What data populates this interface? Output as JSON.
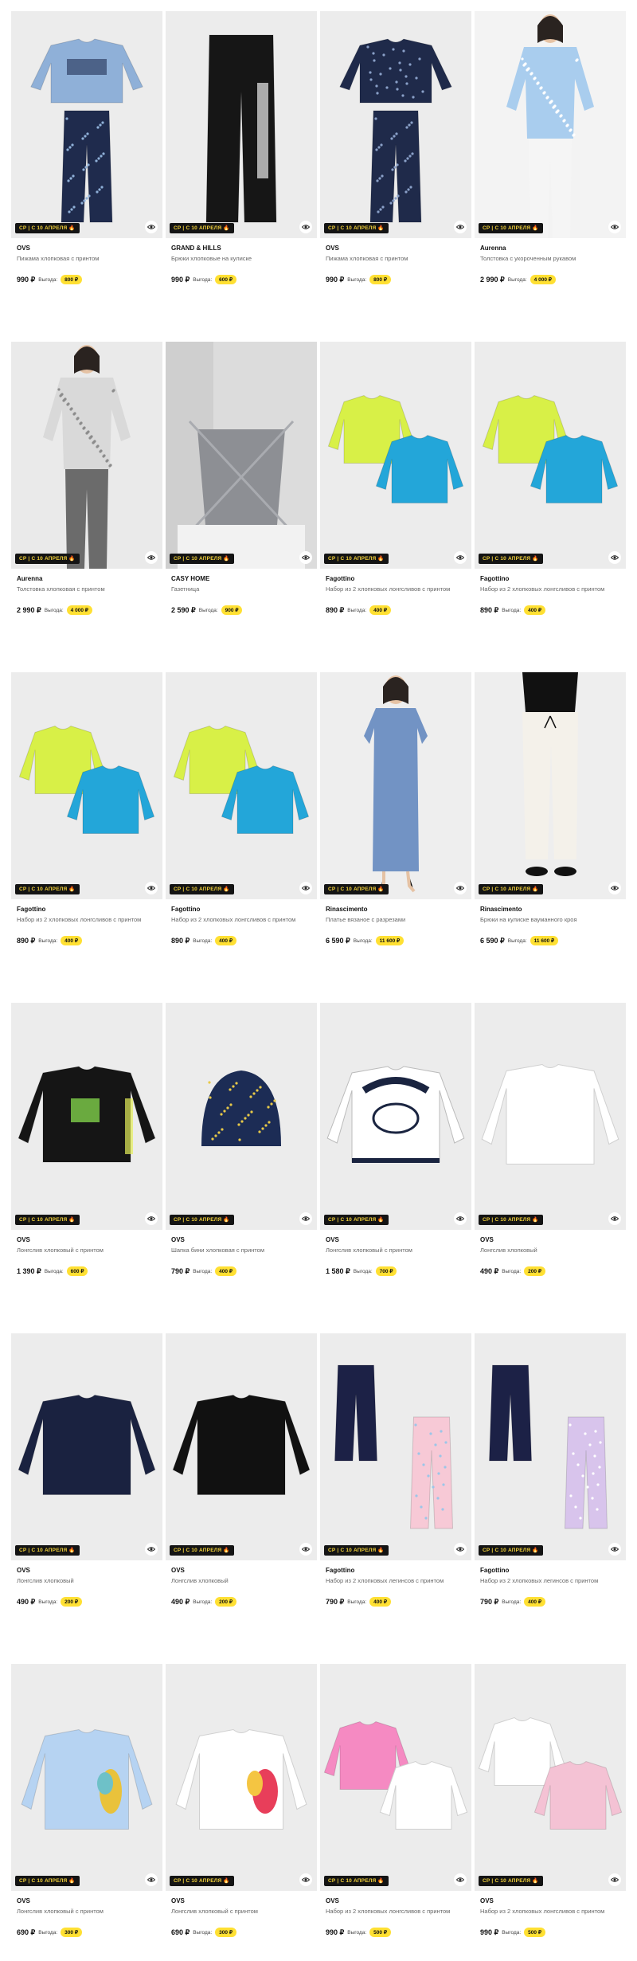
{
  "badge_text": "СР | С 10 АПРЕЛЯ 🔥",
  "save_label": "Выгода:",
  "products": [
    {
      "brand": "OVS",
      "title": "Пижама хлопковая с принтом",
      "price": "990 ₽",
      "save": "800 ₽",
      "icon": "kids-pajama-blue"
    },
    {
      "brand": "GRAND & HILLS",
      "title": "Брюки хлопковые на кулиске",
      "price": "990 ₽",
      "save": "600 ₽",
      "icon": "black-sweatpants"
    },
    {
      "brand": "OVS",
      "title": "Пижама хлопковая с принтом",
      "price": "990 ₽",
      "save": "800 ₽",
      "icon": "kids-pajama-navy"
    },
    {
      "brand": "Aurenna",
      "title": "Толстовка с укороченным рукавом",
      "price": "2 990 ₽",
      "save": "4 000 ₽",
      "icon": "model-blue-top"
    },
    {
      "brand": "Aurenna",
      "title": "Толстовка хлопковая с принтом",
      "price": "2 990 ₽",
      "save": "4 000 ₽",
      "icon": "model-grey-top"
    },
    {
      "brand": "CASY HOME",
      "title": "Газетница",
      "price": "2 590 ₽",
      "save": "900 ₽",
      "icon": "magazine-rack"
    },
    {
      "brand": "Fagottino",
      "title": "Набор из 2 хлопковых лонгсливов с принтом",
      "price": "890 ₽",
      "save": "400 ₽",
      "icon": "two-longsleeves"
    },
    {
      "brand": "Fagottino",
      "title": "Набор из 2 хлопковых лонгсливов с принтом",
      "price": "890 ₽",
      "save": "400 ₽",
      "icon": "two-longsleeves"
    },
    {
      "brand": "Fagottino",
      "title": "Набор из 2 хлопковых лонгсливов с принтом",
      "price": "890 ₽",
      "save": "400 ₽",
      "icon": "two-longsleeves"
    },
    {
      "brand": "Fagottino",
      "title": "Набор из 2 хлопковых лонгсливов с принтом",
      "price": "890 ₽",
      "save": "400 ₽",
      "icon": "two-longsleeves"
    },
    {
      "brand": "Rinascimento",
      "title": "Платье вязаное с разрезами",
      "price": "6 590 ₽",
      "save": "11 600 ₽",
      "icon": "model-blue-dress"
    },
    {
      "brand": "Rinascimento",
      "title": "Брюки на кулиске вауманного кроя",
      "price": "6 590 ₽",
      "save": "11 600 ₽",
      "icon": "model-white-pants"
    },
    {
      "brand": "OVS",
      "title": "Лонгслив хлопковый с принтом",
      "price": "1 390 ₽",
      "save": "600 ₽",
      "icon": "black-sweatshirt"
    },
    {
      "brand": "OVS",
      "title": "Шапка бини хлопковая с принтом",
      "price": "790 ₽",
      "save": "400 ₽",
      "icon": "beanie"
    },
    {
      "brand": "OVS",
      "title": "Лонгслив хлопковый с принтом",
      "price": "1 580 ₽",
      "save": "700 ₽",
      "icon": "athletics-sweatshirt"
    },
    {
      "brand": "OVS",
      "title": "Лонгслив хлопковый",
      "price": "490 ₽",
      "save": "200 ₽",
      "icon": "white-longsleeve"
    },
    {
      "brand": "OVS",
      "title": "Лонгслив хлопковый",
      "price": "490 ₽",
      "save": "200 ₽",
      "icon": "navy-longsleeve"
    },
    {
      "brand": "OVS",
      "title": "Лонгслив хлопковый",
      "price": "490 ₽",
      "save": "200 ₽",
      "icon": "black-longsleeve"
    },
    {
      "brand": "Fagottino",
      "title": "Набор из 2 хлопковых легинсов с принтом",
      "price": "790 ₽",
      "save": "400 ₽",
      "icon": "two-leggings-pink"
    },
    {
      "brand": "Fagottino",
      "title": "Набор из 2 хлопковых легинсов с принтом",
      "price": "790 ₽",
      "save": "400 ₽",
      "icon": "two-leggings-lilac"
    },
    {
      "brand": "OVS",
      "title": "Лонгслив хлопковый с принтом",
      "price": "690 ₽",
      "save": "300 ₽",
      "icon": "blue-longsleeve-print"
    },
    {
      "brand": "OVS",
      "title": "Лонгслив хлопковый с принтом",
      "price": "690 ₽",
      "save": "300 ₽",
      "icon": "white-longsleeve-print"
    },
    {
      "brand": "OVS",
      "title": "Набор из 2 хлопковых лонгсливов с принтом",
      "price": "990 ₽",
      "save": "500 ₽",
      "icon": "two-longsleeves-pink"
    },
    {
      "brand": "OVS",
      "title": "Набор из 2 хлопковых лонгсливов с принтом",
      "price": "990 ₽",
      "save": "500 ₽",
      "icon": "two-longsleeves-white-pink"
    }
  ]
}
